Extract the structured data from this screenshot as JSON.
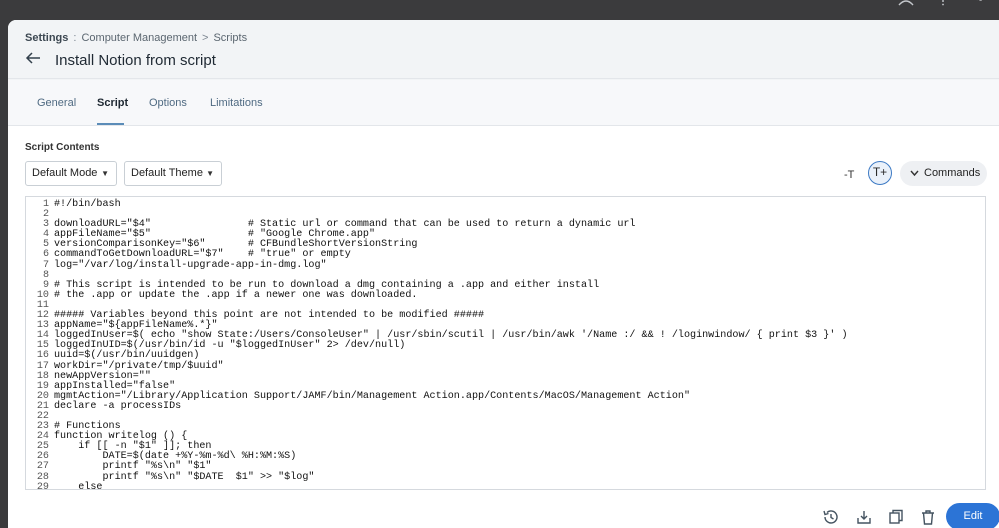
{
  "topbar": {
    "user_icon": "user-icon",
    "help_icon": "help-icon",
    "gear_icon": "gear-icon"
  },
  "breadcrumb": {
    "root": "Settings",
    "separator1": ":",
    "section": "Computer Management",
    "separator2": ">",
    "current": "Scripts"
  },
  "page": {
    "back_icon": "arrow-left-icon",
    "title": "Install Notion from script"
  },
  "tabs": [
    {
      "label": "General"
    },
    {
      "label": "Script"
    },
    {
      "label": "Options"
    },
    {
      "label": "Limitations"
    }
  ],
  "active_tab": "Script",
  "script": {
    "section_label": "Script Contents",
    "mode_select": "Default Mode",
    "theme_select": "Default Theme",
    "font_decrease": "-T",
    "font_increase": "T+",
    "commands_label": "Commands"
  },
  "editor": {
    "line_numbers": [
      "1",
      "2",
      "3",
      "4",
      "5",
      "6",
      "7",
      "8",
      "9",
      "10",
      "11",
      "12",
      "13",
      "14",
      "15",
      "16",
      "17",
      "18",
      "19",
      "20",
      "21",
      "22",
      "23",
      "24",
      "25",
      "26",
      "27",
      "28",
      "29"
    ],
    "lines": [
      "#!/bin/bash",
      "",
      "downloadURL=\"$4\"                # Static url or command that can be used to return a dynamic url",
      "appFileName=\"$5\"                # \"Google Chrome.app\"",
      "versionComparisonKey=\"$6\"       # CFBundleShortVersionString",
      "commandToGetDownloadURL=\"$7\"    # \"true\" or empty",
      "log=\"/var/log/install-upgrade-app-in-dmg.log\"",
      "",
      "# This script is intended to be run to download a dmg containing a .app and either install",
      "# the .app or update the .app if a newer one was downloaded.",
      "",
      "##### Variables beyond this point are not intended to be modified #####",
      "appName=\"${appFileName%.*}\"",
      "loggedInUser=$( echo \"show State:/Users/ConsoleUser\" | /usr/sbin/scutil | /usr/bin/awk '/Name :/ && ! /loginwindow/ { print $3 }' )",
      "loggedInUID=$(/usr/bin/id -u \"$loggedInUser\" 2> /dev/null)",
      "uuid=$(/usr/bin/uuidgen)",
      "workDir=\"/private/tmp/$uuid\"",
      "newAppVersion=\"\"",
      "appInstalled=\"false\"",
      "mgmtAction=\"/Library/Application Support/JAMF/bin/Management Action.app/Contents/MacOS/Management Action\"",
      "declare -a processIDs",
      "",
      "# Functions",
      "function writelog () {",
      "    if [[ -n \"$1\" ]]; then",
      "        DATE=$(date +%Y-%m-%d\\ %H:%M:%S)",
      "        printf \"%s\\n\" \"$1\"",
      "        printf \"%s\\n\" \"$DATE  $1\" >> \"$log\"",
      "    else"
    ]
  },
  "footer": {
    "history_icon": "history-icon",
    "download_icon": "download-icon",
    "clone_icon": "clone-icon",
    "trash_icon": "trash-icon",
    "edit_label": "Edit"
  },
  "colors": {
    "accent": "#2c74d6",
    "active_tab_underline": "#5b8cb8",
    "frame": "#3a3a3c"
  }
}
